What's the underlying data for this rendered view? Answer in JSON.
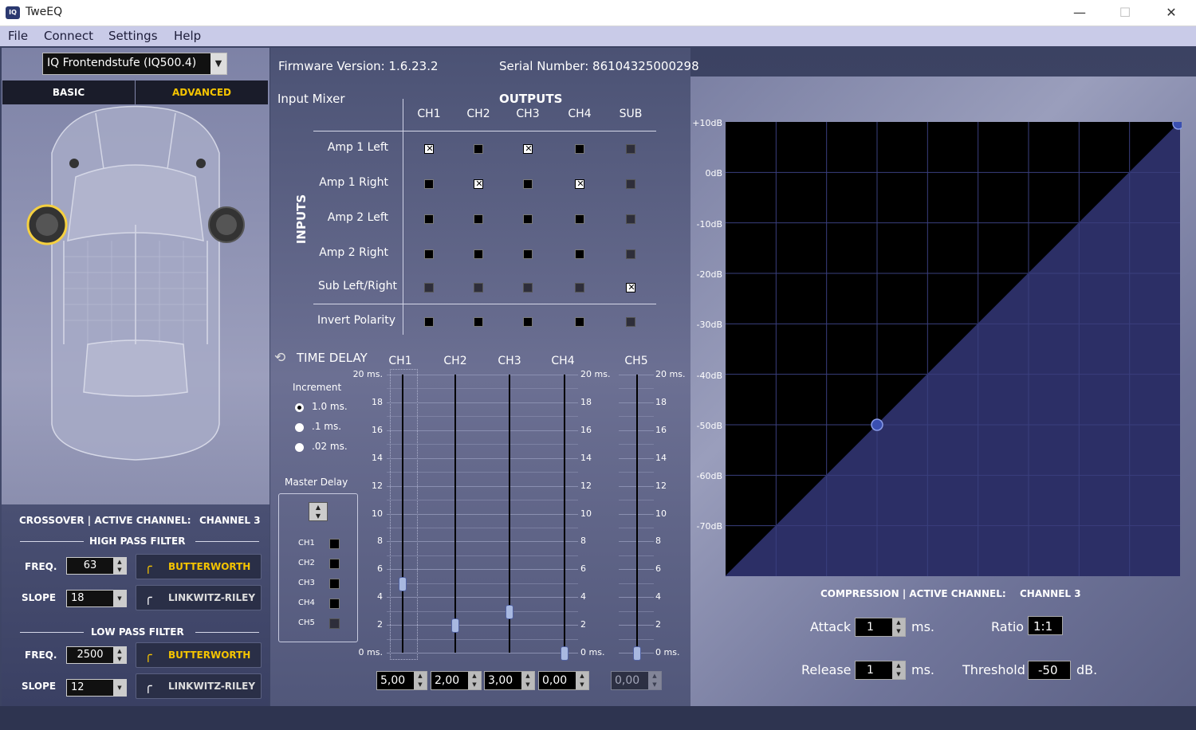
{
  "window": {
    "title": "TweEQ",
    "icon": "app-logo-icon",
    "minimize": "—",
    "maximize": "☐",
    "close": "✕"
  },
  "menu": [
    "File",
    "Connect",
    "Settings",
    "Help"
  ],
  "device": {
    "selected": "IQ Frontendstufe (IQ500.4)",
    "arrow": "▼"
  },
  "tabs": {
    "basic": "BASIC",
    "advanced": "ADVANCED"
  },
  "firmware": "Firmware Version: 1.6.23.2",
  "serial": "Serial Number: 86104325000298",
  "crossover": {
    "title": "CROSSOVER | ACTIVE CHANNEL:",
    "channel": "CHANNEL 3",
    "hpf": {
      "title": "HIGH PASS FILTER",
      "freq_label": "FREQ.",
      "freq": "63",
      "slope_label": "SLOPE",
      "slope": "18",
      "type1": "BUTTERWORTH",
      "type2": "LINKWITZ-RILEY"
    },
    "lpf": {
      "title": "LOW PASS FILTER",
      "freq_label": "FREQ.",
      "freq": "2500",
      "slope_label": "SLOPE",
      "slope": "12",
      "type1": "BUTTERWORTH",
      "type2": "LINKWITZ-RILEY"
    }
  },
  "mixer": {
    "title": "Input Mixer",
    "outputs_label": "OUTPUTS",
    "inputs_label": "INPUTS",
    "columns": [
      "CH1",
      "CH2",
      "CH3",
      "CH4",
      "SUB"
    ],
    "rows": [
      {
        "label": "Amp 1 Left",
        "cells": [
          "x",
          "o",
          "x",
          "o",
          "d"
        ]
      },
      {
        "label": "Amp 1 Right",
        "cells": [
          "o",
          "x",
          "o",
          "x",
          "d"
        ]
      },
      {
        "label": "Amp 2 Left",
        "cells": [
          "o",
          "o",
          "o",
          "o",
          "d"
        ]
      },
      {
        "label": "Amp 2 Right",
        "cells": [
          "o",
          "o",
          "o",
          "o",
          "d"
        ]
      },
      {
        "label": "Sub Left/Right",
        "cells": [
          "d",
          "d",
          "d",
          "d",
          "x"
        ]
      }
    ],
    "invert": {
      "label": "Invert Polarity",
      "cells": [
        "o",
        "o",
        "o",
        "o",
        "d"
      ]
    }
  },
  "delay": {
    "title": "TIME DELAY",
    "channels": [
      "CH1",
      "CH2",
      "CH3",
      "CH4",
      "CH5"
    ],
    "values": [
      "5,00",
      "2,00",
      "3,00",
      "0,00",
      "0,00"
    ],
    "levels_ms": [
      5,
      2,
      3,
      0,
      0
    ],
    "max_ms": 20,
    "scale_left": [
      "20 ms.",
      "18",
      "16",
      "14",
      "12",
      "10",
      "8",
      "6",
      "4",
      "2",
      "0 ms."
    ],
    "scale_mid": [
      "20 ms.",
      "18",
      "16",
      "14",
      "12",
      "10",
      "8",
      "6",
      "4",
      "2",
      "0 ms."
    ],
    "scale_right": [
      "20 ms.",
      "18",
      "16",
      "14",
      "12",
      "10",
      "8",
      "6",
      "4",
      "2",
      "0 ms."
    ],
    "increment_label": "Increment",
    "increments": [
      "1.0 ms.",
      ".1 ms.",
      ".02 ms."
    ],
    "master_label": "Master Delay",
    "master_channels": [
      "CH1",
      "CH2",
      "CH3",
      "CH4",
      "CH5"
    ]
  },
  "compression": {
    "title": "COMPRESSION | ACTIVE CHANNEL:",
    "channel": "CHANNEL 3",
    "db_labels": [
      "+10dB",
      "0dB",
      "-10dB",
      "-20dB",
      "-30dB",
      "-40dB",
      "-50dB",
      "-60dB",
      "-70dB"
    ],
    "attack_label": "Attack",
    "attack": "1",
    "attack_unit": "ms.",
    "release_label": "Release",
    "release": "1",
    "release_unit": "ms.",
    "ratio_label": "Ratio",
    "ratio": "1:1",
    "threshold_label": "Threshold",
    "threshold": "-50",
    "threshold_unit": "dB."
  },
  "colors": {
    "accent": "#f5c400",
    "graph_fill": "#2c2f66",
    "panel": "#8a8fb0"
  }
}
